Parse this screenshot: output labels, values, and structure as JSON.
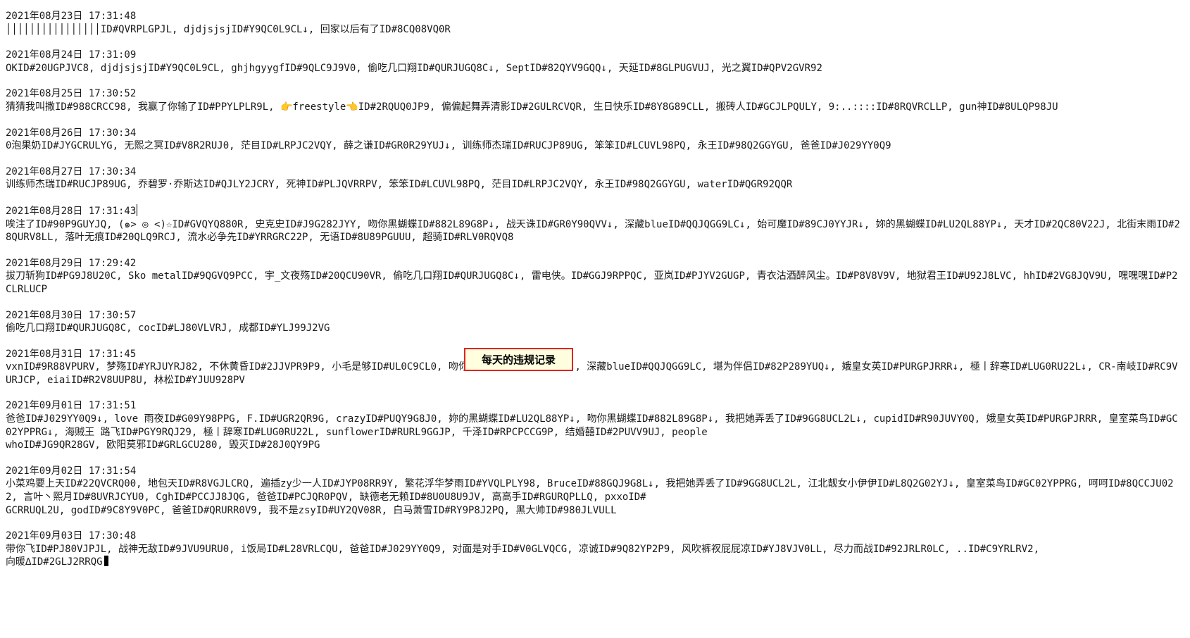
{
  "editor": {
    "entries": [
      {
        "date": "2021年08月23日 17:31:48",
        "content": "││││││││││││││││ID#QVRPLGPJL, djdjsjsjID#Y9QC0L9CL↓, 回家以后有了ID#8CQ08VQ0R"
      },
      {
        "date": "2021年08月24日 17:31:09",
        "content": "OKID#20UGPJVC8, djdjsjsjID#Y9QC0L9CL, ghjhgyygfID#9QLC9J9V0, 偷吃几口翔ID#QURJUGQ8C↓, SeptID#82QYV9GQQ↓, 天延ID#8GLPUGVUJ, 光之翼ID#QPV2GVR92"
      },
      {
        "date": "2021年08月25日 17:30:52",
        "content": "猜猜我叫撒ID#988CRCC98, 我赢了你输了ID#PPYLPLR9L, 👉freestyle👈ID#2RQUQ0JP9, 偏偏起舞弄清影ID#2GULRCVQR, 生日快乐ID#8Y8G89CLL, 搬砖人ID#GCJLPQULY, 9:..::::ID#8RQVRCLLP, gun神ID#8ULQP98JU"
      },
      {
        "date": "2021年08月26日 17:30:34",
        "content": "0泡果奶ID#JYGCRULYG, 无熙之冥ID#V8R2RUJ0, 茫目ID#LRPJC2VQY, 薛之谦ID#GR0R29YUJ↓, 训练师杰瑞ID#RUCJP89UG, 笨笨ID#LCUVL98PQ, 永王ID#98Q2GGYGU, 爸爸ID#J029YY0Q9"
      },
      {
        "date": "2021年08月27日 17:30:34",
        "content": "训练师杰瑞ID#RUCJP89UG, 乔碧罗·乔斯达ID#QJLY2JCRY, 死神ID#PLJQVRRPV, 笨笨ID#LCUVL98PQ, 茫目ID#LRPJC2VQY, 永王ID#98Q2GGYGU, waterID#QGR92QQR"
      },
      {
        "date": "2021年08月28日 17:31:43",
        "content": "唉注了ID#90P9GUYJQ, (๑> ◎ <)☆ID#GVQYQ880R, 史克史ID#J9G282JYY, 吻你黑蝴蝶ID#882L89G8P↓, 战天诛ID#GR0Y90QVV↓, 深藏blueID#QQJQGG9LC↓, 始可魔ID#89CJ0YYJR↓, 妳的黑蝴蝶ID#LU2QL88YP↓, 天才ID#2QC80V22J, 北街末雨ID#28QURV8LL, 落叶无痕ID#20QLQ9RCJ, 流水必争先ID#YRRGRC22P, 无语ID#8U89PGUUU, 超骑ID#RLV0RQVQ8"
      },
      {
        "date": "2021年08月29日 17:29:42",
        "content": "拔刀斩狗ID#PG9J8U20C, Sko metalID#9QGVQ9PCC, 宇_文夜殇ID#20QCU90VR, 偷吃几口翔ID#QURJUGQ8C↓, 雷电侠。ID#GGJ9RPPQC, 亚岚ID#PJYV2GUGP, 青衣沽酒醉风尘。ID#P8V8V9V, 地狱君王ID#U92J8LVC, hhID#2VG8JQV9U, 嘿嘿嘿ID#P2CLRLUCP"
      },
      {
        "date": "2021年08月30日 17:30:57",
        "content": "偷吃几口翔ID#QURJUGQ8C, cocID#LJ80VLVRJ, 成都ID#YLJ99J2VG"
      },
      {
        "date": "2021年08月31日 17:31:45",
        "content": "vxnID#9R88VPURV, 梦殇ID#YRJUYRJ82, 不休黄昏ID#2JJVPR9P9, 小毛是够ID#UL0C9CL0, 吻你黑蝴蝶ID#882L89G8P↓, 深藏blueID#QQJQGG9LC, 堪为伴侣ID#82P289YUQ↓, 娥皇女英ID#PURGPJRRR↓, 極丨辞寒ID#LUG0RU22L↓, CR-南岐ID#RC9VURJCP, eiaiID#R2V8UUP8U, 林松ID#YJUU928PV"
      },
      {
        "date": "2021年09月01日 17:31:51",
        "content": "爸爸ID#J029YY0Q9↓, love 雨夜ID#G09Y98PPG, F.ID#UGR2QR9G, crazyID#PUQY9G8J0, 妳的黑蝴蝶ID#LU2QL88YP↓, 吻你黑蝴蝶ID#882L89G8P↓, 我把她弄丢了ID#9GG8UCL2L↓, cupidID#R90JUVY0Q, 娥皇女英ID#PURGPJRRR, 皇室菜鸟ID#GC02YPPRG↓, 海贼王 路飞ID#PGY9RQJ29, 極丨辞寒ID#LUG0RU22L, sunflowerID#RURL9GGJP, 千泽ID#RPCPCCG9P, 结婚囍ID#2PUVV9UJ, people\nwhoID#JG9QR28GV, 欧阳莫邪ID#GRLGCU280, 毁灭ID#28J0QY9PG"
      },
      {
        "date": "2021年09月02日 17:31:54",
        "content": "小菜鸡要上天ID#22QVCRQ00, 地包天ID#R8VGJLCRQ, 遍插zy少一人ID#JYP08RR9Y, 繁花浮华梦雨ID#YVQLPLY98, BruceID#88GQJ9G8L↓, 我把她弄丢了ID#9GG8UCL2L, 江北靓女小伊伊ID#L8Q2G02YJ↓, 皇室菜鸟ID#GC02YPPRG, 呵呵ID#8QCCJU022, 言叶丶熙月ID#8UVRJCYU0, CghID#PCCJJ8JQG, 爸爸ID#PCJQR0PQV, 缺德老无赖ID#8U0U8U9JV, 高高手ID#RGURQPLLQ, pxxoID#\nGCRRUQL2U, godID#9C8Y9V0PC, 爸爸ID#QRURR0V9, 我不是zsyID#UY2QV08R, 白马萧雪ID#RY9P8J2PQ, 黑大帅ID#980JLVULL"
      },
      {
        "date": "2021年09月03日 17:30:48",
        "content": "带你飞ID#PJ80VJPJL, 战神无敌ID#9JVU9URU0, i饭局ID#L28VRLCQU, 爸爸ID#J029YY0Q9, 对面是对手ID#V0GLVQCG, 凉诚ID#9Q82YP2P9, 风吹裤衩屁屁凉ID#YJ8VJV0LL, 尽力而战ID#92JRLR0LC, ..ID#C9YRLRV2,\n向暖∆ID#2GLJ2RRQG"
      }
    ]
  },
  "annotation": {
    "label": "每天的违规记录"
  }
}
